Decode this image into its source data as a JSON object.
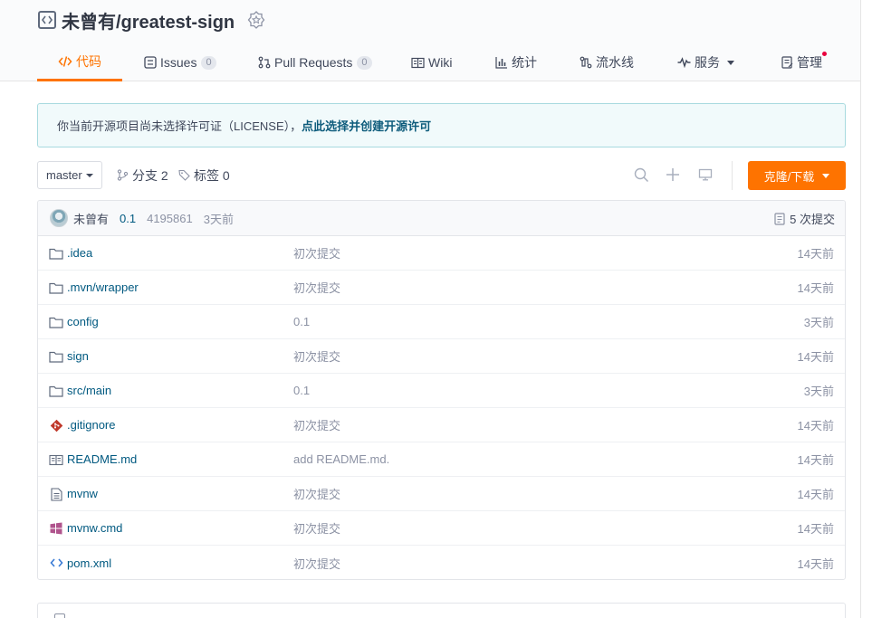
{
  "repo": {
    "name": "未曾有/greatest-sign"
  },
  "nav": {
    "code": "代码",
    "issues": "Issues",
    "issues_count": "0",
    "pulls": "Pull Requests",
    "pulls_count": "0",
    "wiki": "Wiki",
    "stats": "统计",
    "pipeline": "流水线",
    "services": "服务",
    "manage": "管理"
  },
  "notice": {
    "text": "你当前开源项目尚未选择许可证（LICENSE），",
    "link": "点此选择并创建开源许可"
  },
  "toolbar": {
    "branch": "master",
    "branches_label": "分支 2",
    "tags_label": "标签 0",
    "clone_label": "克隆/下载"
  },
  "commit": {
    "author": "未曾有",
    "message": "0.1",
    "hash": "4195861",
    "time": "3天前",
    "count_label": "5 次提交"
  },
  "files": [
    {
      "name": ".idea",
      "commit": "初次提交",
      "time": "14天前",
      "icon": "folder-icon"
    },
    {
      "name": ".mvn/wrapper",
      "commit": "初次提交",
      "time": "14天前",
      "icon": "folder-icon"
    },
    {
      "name": "config",
      "commit": "0.1",
      "time": "3天前",
      "icon": "folder-icon"
    },
    {
      "name": "sign",
      "commit": "初次提交",
      "time": "14天前",
      "icon": "folder-icon"
    },
    {
      "name": "src/main",
      "commit": "0.1",
      "time": "3天前",
      "icon": "folder-icon"
    },
    {
      "name": ".gitignore",
      "commit": "初次提交",
      "time": "14天前",
      "icon": "git-icon"
    },
    {
      "name": "README.md",
      "commit": "add README.md.",
      "time": "14天前",
      "icon": "readme-icon"
    },
    {
      "name": "mvnw",
      "commit": "初次提交",
      "time": "14天前",
      "icon": "file-icon"
    },
    {
      "name": "mvnw.cmd",
      "commit": "初次提交",
      "time": "14天前",
      "icon": "windows-icon"
    },
    {
      "name": "pom.xml",
      "commit": "初次提交",
      "time": "14天前",
      "icon": "code-icon"
    }
  ],
  "colors": {
    "accent": "#fe7300",
    "link": "#005980",
    "muted": "#8c92a4"
  }
}
